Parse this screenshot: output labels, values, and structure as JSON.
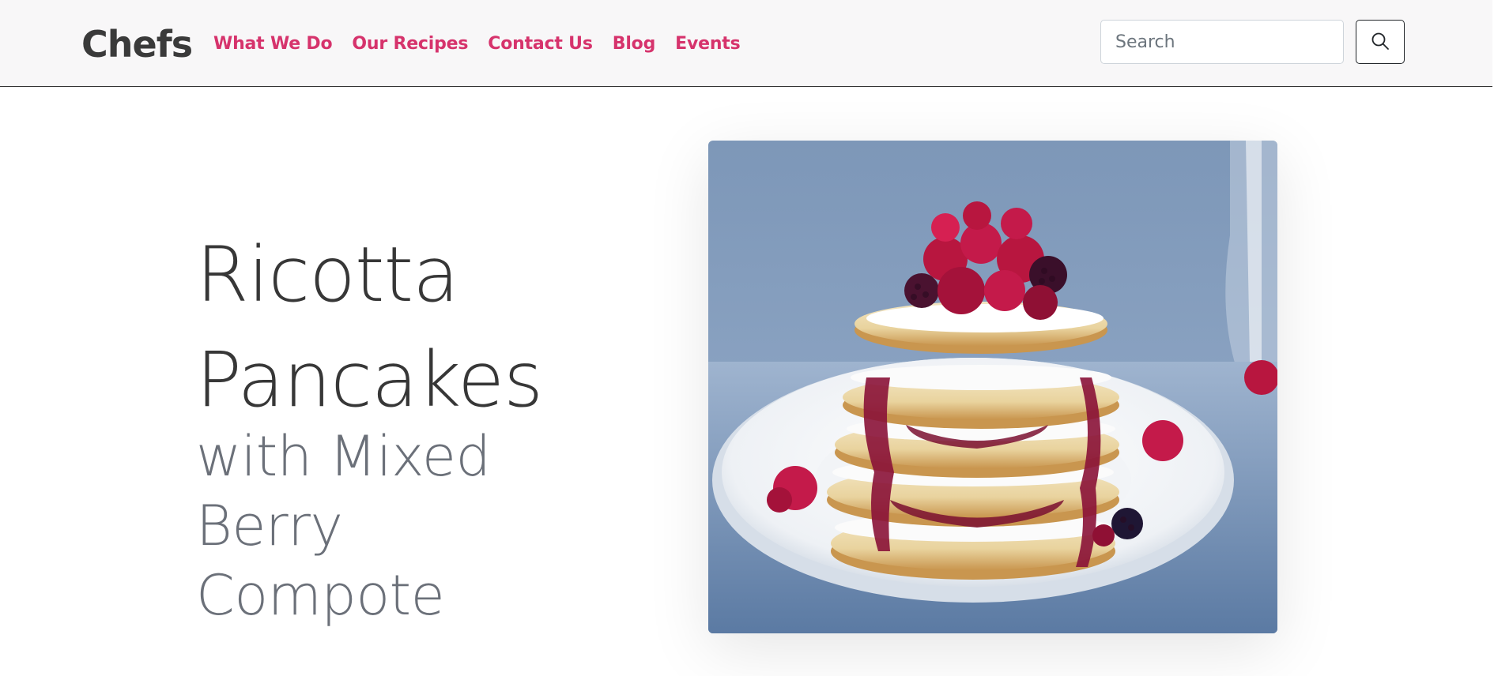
{
  "brand": "Chefs",
  "nav": {
    "links": [
      "What We Do",
      "Our Recipes",
      "Contact Us",
      "Blog",
      "Events"
    ]
  },
  "search": {
    "placeholder": "Search",
    "value": "",
    "button_icon": "search-icon"
  },
  "hero": {
    "title_line1": "Ricotta",
    "title_line2": "Pancakes",
    "subtitle_line1": "with Mixed Berry",
    "subtitle_line2": "Compote"
  },
  "colors": {
    "accent": "#d6336c",
    "navbar_bg": "#f8f7f8",
    "title": "#373737",
    "subtitle": "#6b7079"
  }
}
